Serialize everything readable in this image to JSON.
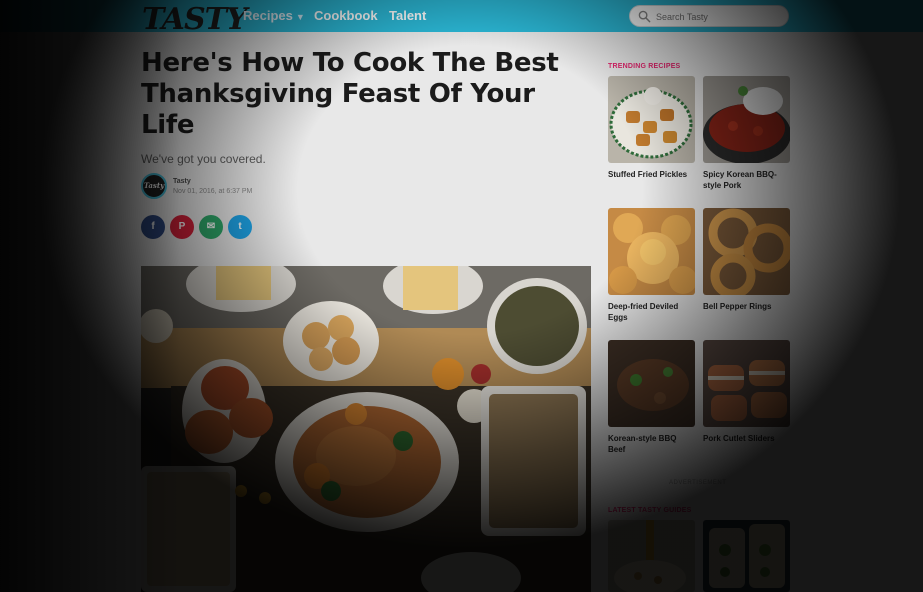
{
  "nav": {
    "logo": "TASTY",
    "items": [
      {
        "label": "Recipes",
        "has_dropdown": true
      },
      {
        "label": "Cookbook"
      },
      {
        "label": "Talent"
      }
    ],
    "search_placeholder": "Search Tasty"
  },
  "article": {
    "title": "Here's How To Cook The Best Thanksgiving Feast Of Your Life",
    "subtitle": "We've got you covered.",
    "author": "Tasty",
    "date": "Nov 01, 2016, at 6:37 PM",
    "share": [
      {
        "label": "f",
        "icon": "facebook-icon"
      },
      {
        "label": "P",
        "icon": "pinterest-icon"
      },
      {
        "label": "✉",
        "icon": "email-icon"
      },
      {
        "label": "t",
        "icon": "twitter-icon"
      }
    ]
  },
  "sidebar": {
    "trending_label": "TRENDING RECIPES",
    "cards": [
      {
        "title": "Stuffed Fried Pickles"
      },
      {
        "title": "Spicy Korean BBQ-style Pork"
      },
      {
        "title": "Deep-fried Deviled Eggs"
      },
      {
        "title": "Bell Pepper Rings"
      },
      {
        "title": "Korean-style BBQ Beef"
      },
      {
        "title": "Pork Cutlet Sliders"
      }
    ],
    "advertisement": "ADVERTISEMENT",
    "guides_label": "LATEST TASTY GUIDES"
  },
  "colors": {
    "nav_bg": "#2bb8d6",
    "accent_pink": "#e4266e",
    "facebook": "#2f4b86",
    "pinterest": "#d6213a",
    "email": "#2fa86a",
    "twitter": "#1ea3e6"
  }
}
